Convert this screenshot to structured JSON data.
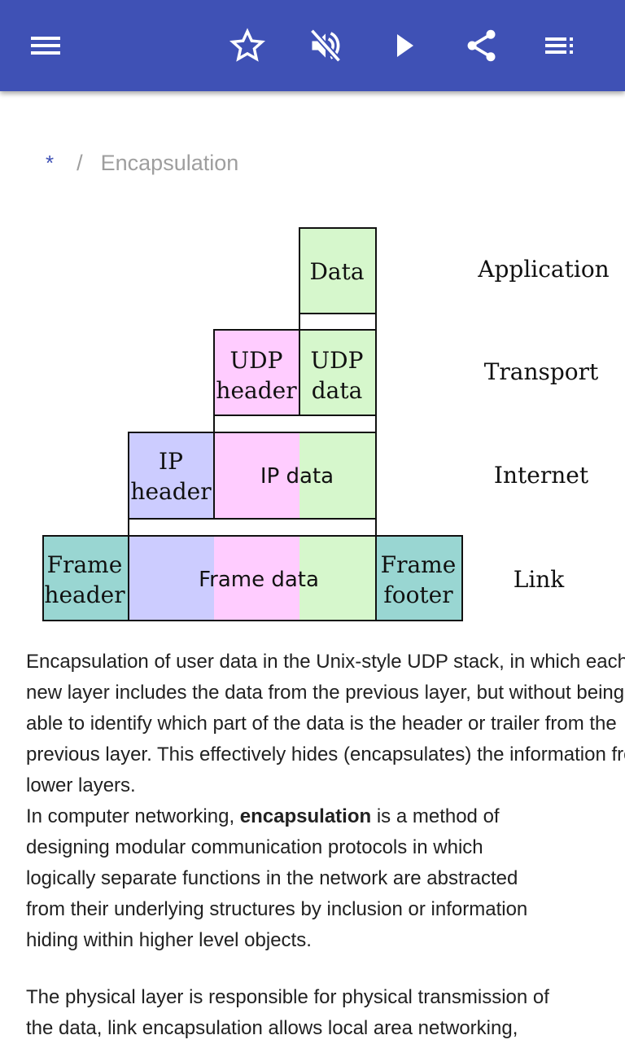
{
  "appbar": {
    "background": "#3f51b5",
    "icons": {
      "menu": "menu-icon",
      "favorite": "star-outline-icon",
      "mute": "volume-off-icon",
      "play": "play-icon",
      "share": "share-icon",
      "contents": "list-icon"
    }
  },
  "breadcrumb": {
    "root": "*",
    "separator": "/",
    "current": "Encapsulation"
  },
  "diagram": {
    "layers": {
      "application": "Application",
      "transport": "Transport",
      "internet": "Internet",
      "link": "Link"
    },
    "blocks": {
      "data": "Data",
      "udp_header_line1": "UDP",
      "udp_header_line2": "header",
      "udp_data_line1": "UDP",
      "udp_data_line2": "data",
      "ip_header_line1": "IP",
      "ip_header_line2": "header",
      "ip_data": "IP data",
      "frame_header_line1": "Frame",
      "frame_header_line2": "header",
      "frame_data": "Frame data",
      "frame_footer_line1": "Frame",
      "frame_footer_line2": "footer"
    },
    "colors": {
      "application_data": "#d6f7cc",
      "udp_header": "#ffccff",
      "ip_header": "#ccccff",
      "frame": "#99d6d2"
    }
  },
  "article": {
    "caption_lines": [
      "Encapsulation of user data in the Unix-style UDP stack, in which each",
      "new layer includes the data from the previous layer, but without being",
      "able to identify which part of the data is the header or trailer from the",
      "previous layer. This effectively hides (encapsulates) the information from",
      "lower layers."
    ],
    "intro": {
      "prefix": "In computer networking, ",
      "term": "encapsulation",
      "line1_suffix": " is a method of",
      "lines": [
        "designing modular communication protocols in which",
        "logically separate functions in the network are abstracted",
        "from their underlying structures by inclusion or information",
        "hiding within higher level objects."
      ]
    },
    "paragraph2_lines": [
      "The physical layer is responsible for physical transmission of",
      "the data, link encapsulation allows local area networking,"
    ]
  }
}
